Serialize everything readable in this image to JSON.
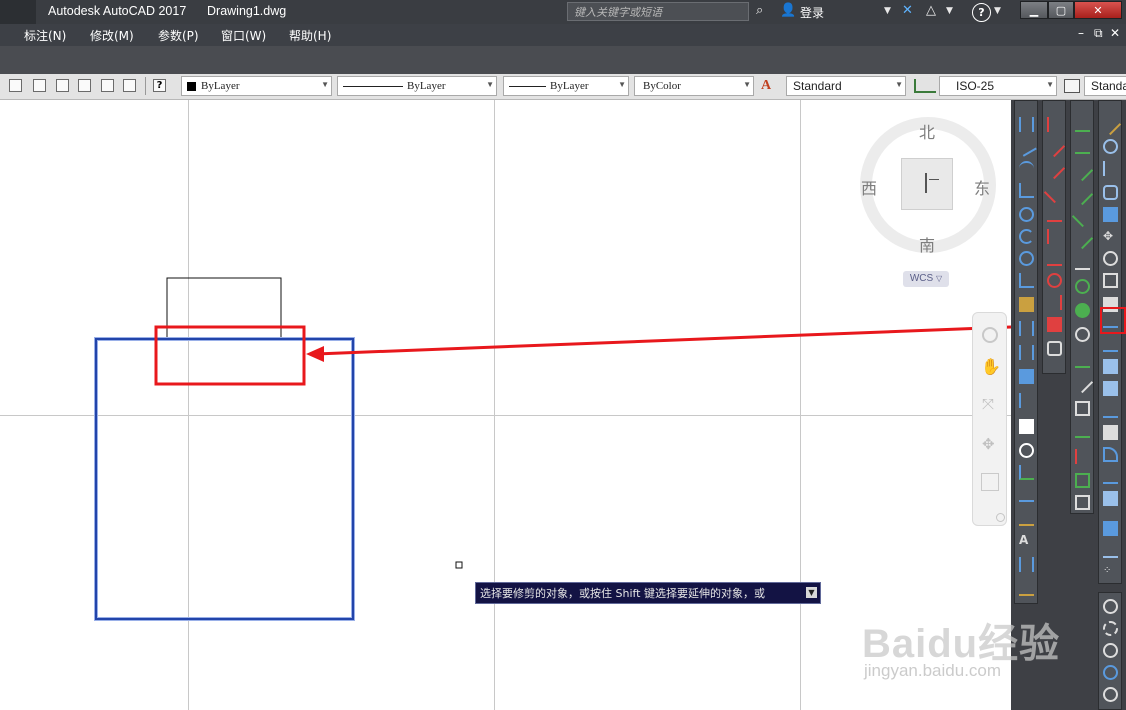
{
  "titlebar": {
    "app_name": "Autodesk AutoCAD 2017",
    "document": "Drawing1.dwg",
    "search_placeholder": "键入关键字或短语",
    "login": "登录",
    "help": "?"
  },
  "menu": {
    "items": [
      "标注(N)",
      "修改(M)",
      "参数(P)",
      "窗口(W)",
      "帮助(H)"
    ]
  },
  "properties": {
    "color": "ByLayer",
    "linetype": "ByLayer",
    "lineweight": "ByLayer",
    "plotstyle": "ByColor",
    "text_style": "Standard",
    "dim_style": "ISO-25",
    "table_style": "Standa"
  },
  "viewcube": {
    "north": "北",
    "south": "南",
    "east": "东",
    "west": "西",
    "ucs": "WCS"
  },
  "command_prompt": "选择要修剪的对象，或按住 Shift 键选择要延伸的对象，或",
  "watermark": {
    "logo": "Baidu经验",
    "url": "jingyan.baidu.com"
  },
  "colors": {
    "highlight_red": "#e8181c",
    "selected_blue": "#2244aa",
    "prompt_bg": "#131344",
    "titlebar_bg": "#3a3d42"
  }
}
